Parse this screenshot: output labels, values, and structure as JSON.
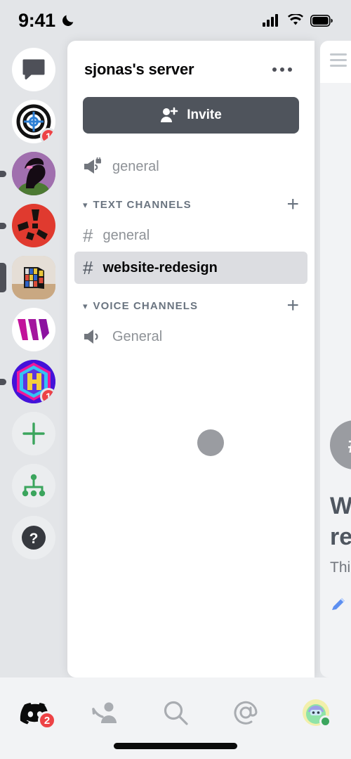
{
  "status_bar": {
    "time": "9:41",
    "dnd_icon": "crescent-moon-icon",
    "cellular_icon": "signal-bars-icon",
    "wifi_icon": "wifi-icon",
    "battery_icon": "battery-full-icon"
  },
  "server_rail": {
    "items": [
      {
        "id": "direct-messages",
        "label": "Direct Messages",
        "icon": "speech-bubble-icon",
        "kind": "dm",
        "badge": "",
        "indicator": "none"
      },
      {
        "id": "target-server",
        "label": "Target server",
        "icon": "target-icon",
        "kind": "icon",
        "badge": "1",
        "indicator": "none"
      },
      {
        "id": "purple-avatar-server",
        "label": "Purple avatar server",
        "icon": "avatar-image",
        "kind": "photo",
        "badge": "",
        "indicator": "dot"
      },
      {
        "id": "red-server",
        "label": "Red server",
        "icon": "red-shapes-icon",
        "kind": "icon",
        "badge": "",
        "indicator": "dot"
      },
      {
        "id": "rubiks-cube-server",
        "label": "Rubik's cube server",
        "icon": "cube-photo",
        "kind": "photo",
        "badge": "",
        "indicator": "active"
      },
      {
        "id": "w-server",
        "label": "W server",
        "icon": "w-logo-icon",
        "kind": "icon",
        "badge": "",
        "indicator": "none"
      },
      {
        "id": "hex-server",
        "label": "Hex server",
        "icon": "hex-logo-icon",
        "kind": "icon",
        "badge": "1",
        "indicator": "dot"
      },
      {
        "id": "add-server",
        "label": "Add a Server",
        "icon": "plus-icon",
        "kind": "action",
        "badge": "",
        "indicator": "none"
      },
      {
        "id": "explore-servers",
        "label": "Explore Public Servers",
        "icon": "compass-hierarchy-icon",
        "kind": "action",
        "badge": "",
        "indicator": "none"
      },
      {
        "id": "help",
        "label": "Help",
        "icon": "question-mark-icon",
        "kind": "action",
        "badge": "",
        "indicator": "none"
      }
    ]
  },
  "server_panel": {
    "title": "sjonas's server",
    "overflow_icon": "more-options-icon",
    "invite": {
      "label": "Invite",
      "icon": "person-add-icon"
    },
    "announcement_channel": {
      "name": "general",
      "icon": "announcement-locked-icon"
    },
    "categories": [
      {
        "name": "TEXT CHANNELS",
        "collapse_icon": "chevron-down-icon",
        "add_icon": "plus-icon",
        "channels": [
          {
            "name": "general",
            "icon": "hash-icon",
            "selected": false
          },
          {
            "name": "website-redesign",
            "icon": "hash-icon",
            "selected": true
          }
        ]
      },
      {
        "name": "VOICE CHANNELS",
        "collapse_icon": "chevron-down-icon",
        "add_icon": "plus-icon",
        "channels": [
          {
            "name": "General",
            "icon": "speaker-icon",
            "selected": false
          }
        ]
      }
    ],
    "loading_indicator": "drag-handle-dot"
  },
  "chat_peek": {
    "menu_icon": "hamburger-menu-icon",
    "avatar_letter": "#",
    "heading_line1": "W",
    "heading_line2": "re",
    "body_text": "Thi",
    "edit_icon": "pencil-icon"
  },
  "tab_bar": {
    "tabs": [
      {
        "id": "home",
        "label": "Home",
        "icon": "discord-logo-icon",
        "active": true,
        "badge": "2"
      },
      {
        "id": "friends",
        "label": "Friends",
        "icon": "friends-icon",
        "active": false,
        "badge": ""
      },
      {
        "id": "search",
        "label": "Search",
        "icon": "search-icon",
        "active": false,
        "badge": ""
      },
      {
        "id": "mentions",
        "label": "Mentions",
        "icon": "at-mention-icon",
        "active": false,
        "badge": ""
      },
      {
        "id": "profile",
        "label": "You",
        "icon": "user-avatar-icon",
        "active": false,
        "badge": ""
      }
    ]
  },
  "colors": {
    "badge_red": "#ed4245",
    "invite_gray": "#4f545c",
    "accent_green": "#3ba55d",
    "panel_bg": "#ffffff",
    "rail_bg": "#e3e5e8"
  }
}
